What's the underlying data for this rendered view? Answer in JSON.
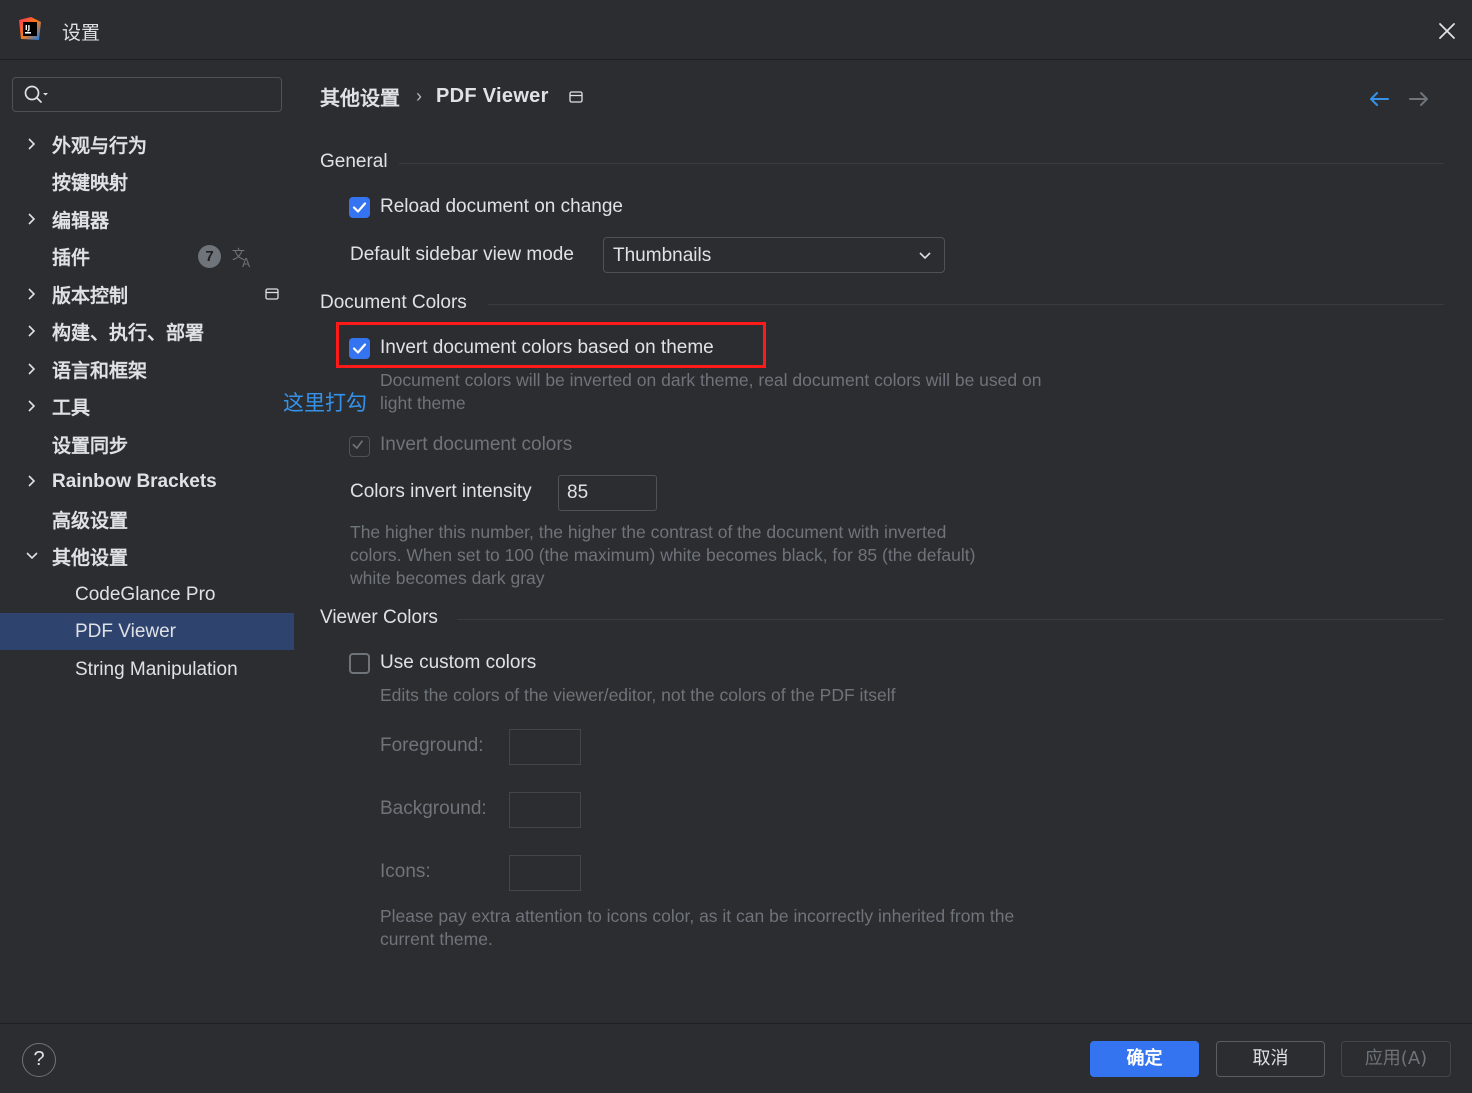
{
  "window": {
    "title": "设置"
  },
  "sidebar": {
    "search_placeholder": "",
    "items": [
      {
        "label": "外观与行为",
        "expandable": true
      },
      {
        "label": "按键映射",
        "expandable": false
      },
      {
        "label": "编辑器",
        "expandable": true
      },
      {
        "label": "插件",
        "expandable": false,
        "badge": "7"
      },
      {
        "label": "版本控制",
        "expandable": true
      },
      {
        "label": "构建、执行、部署",
        "expandable": true
      },
      {
        "label": "语言和框架",
        "expandable": true
      },
      {
        "label": "工具",
        "expandable": true
      },
      {
        "label": "设置同步",
        "expandable": false
      },
      {
        "label": "Rainbow Brackets",
        "expandable": true
      },
      {
        "label": "高级设置",
        "expandable": false
      },
      {
        "label": "其他设置",
        "expandable": true,
        "expanded": true
      },
      {
        "label": "CodeGlance Pro",
        "child": true
      },
      {
        "label": "PDF Viewer",
        "child": true,
        "selected": true
      },
      {
        "label": "String Manipulation",
        "child": true
      }
    ]
  },
  "header": {
    "breadcrumb_parent": "其他设置",
    "breadcrumb_separator": "›",
    "breadcrumb_current": "PDF Viewer"
  },
  "general": {
    "title": "General",
    "reload_label": "Reload document on change",
    "reload_checked": true,
    "sidebar_mode_label": "Default sidebar view mode",
    "sidebar_mode_value": "Thumbnails"
  },
  "document_colors": {
    "title": "Document Colors",
    "invert_theme_label": "Invert document colors based on theme",
    "invert_theme_checked": true,
    "invert_theme_help_1": "Document colors will be inverted on dark theme, real document colors will be used on",
    "invert_theme_help_2": "light theme",
    "invert_label": "Invert document colors",
    "invert_checked": true,
    "intensity_label": "Colors invert intensity",
    "intensity_value": "85",
    "intensity_help_1": "The higher this number, the higher the contrast of the document with inverted",
    "intensity_help_2": "colors. When set to 100 (the maximum) white becomes black, for 85 (the default)",
    "intensity_help_3": "white becomes dark gray"
  },
  "viewer_colors": {
    "title": "Viewer Colors",
    "custom_label": "Use custom colors",
    "custom_checked": false,
    "custom_help": "Edits the colors of the viewer/editor, not the colors of the PDF itself",
    "foreground_label": "Foreground:",
    "background_label": "Background:",
    "icons_label": "Icons:",
    "icons_help_1": "Please pay extra attention to icons color, as it can be incorrectly inherited from the",
    "icons_help_2": "current theme."
  },
  "annotation": {
    "text": "这里打勾",
    "color": "#ff1a1a",
    "text_color": "#3592e8"
  },
  "footer": {
    "help": "?",
    "ok": "确定",
    "cancel": "取消",
    "apply": "应用(A)"
  },
  "colors": {
    "accent": "#3574f0",
    "background": "#2b2d30",
    "selected": "#2e436e"
  }
}
